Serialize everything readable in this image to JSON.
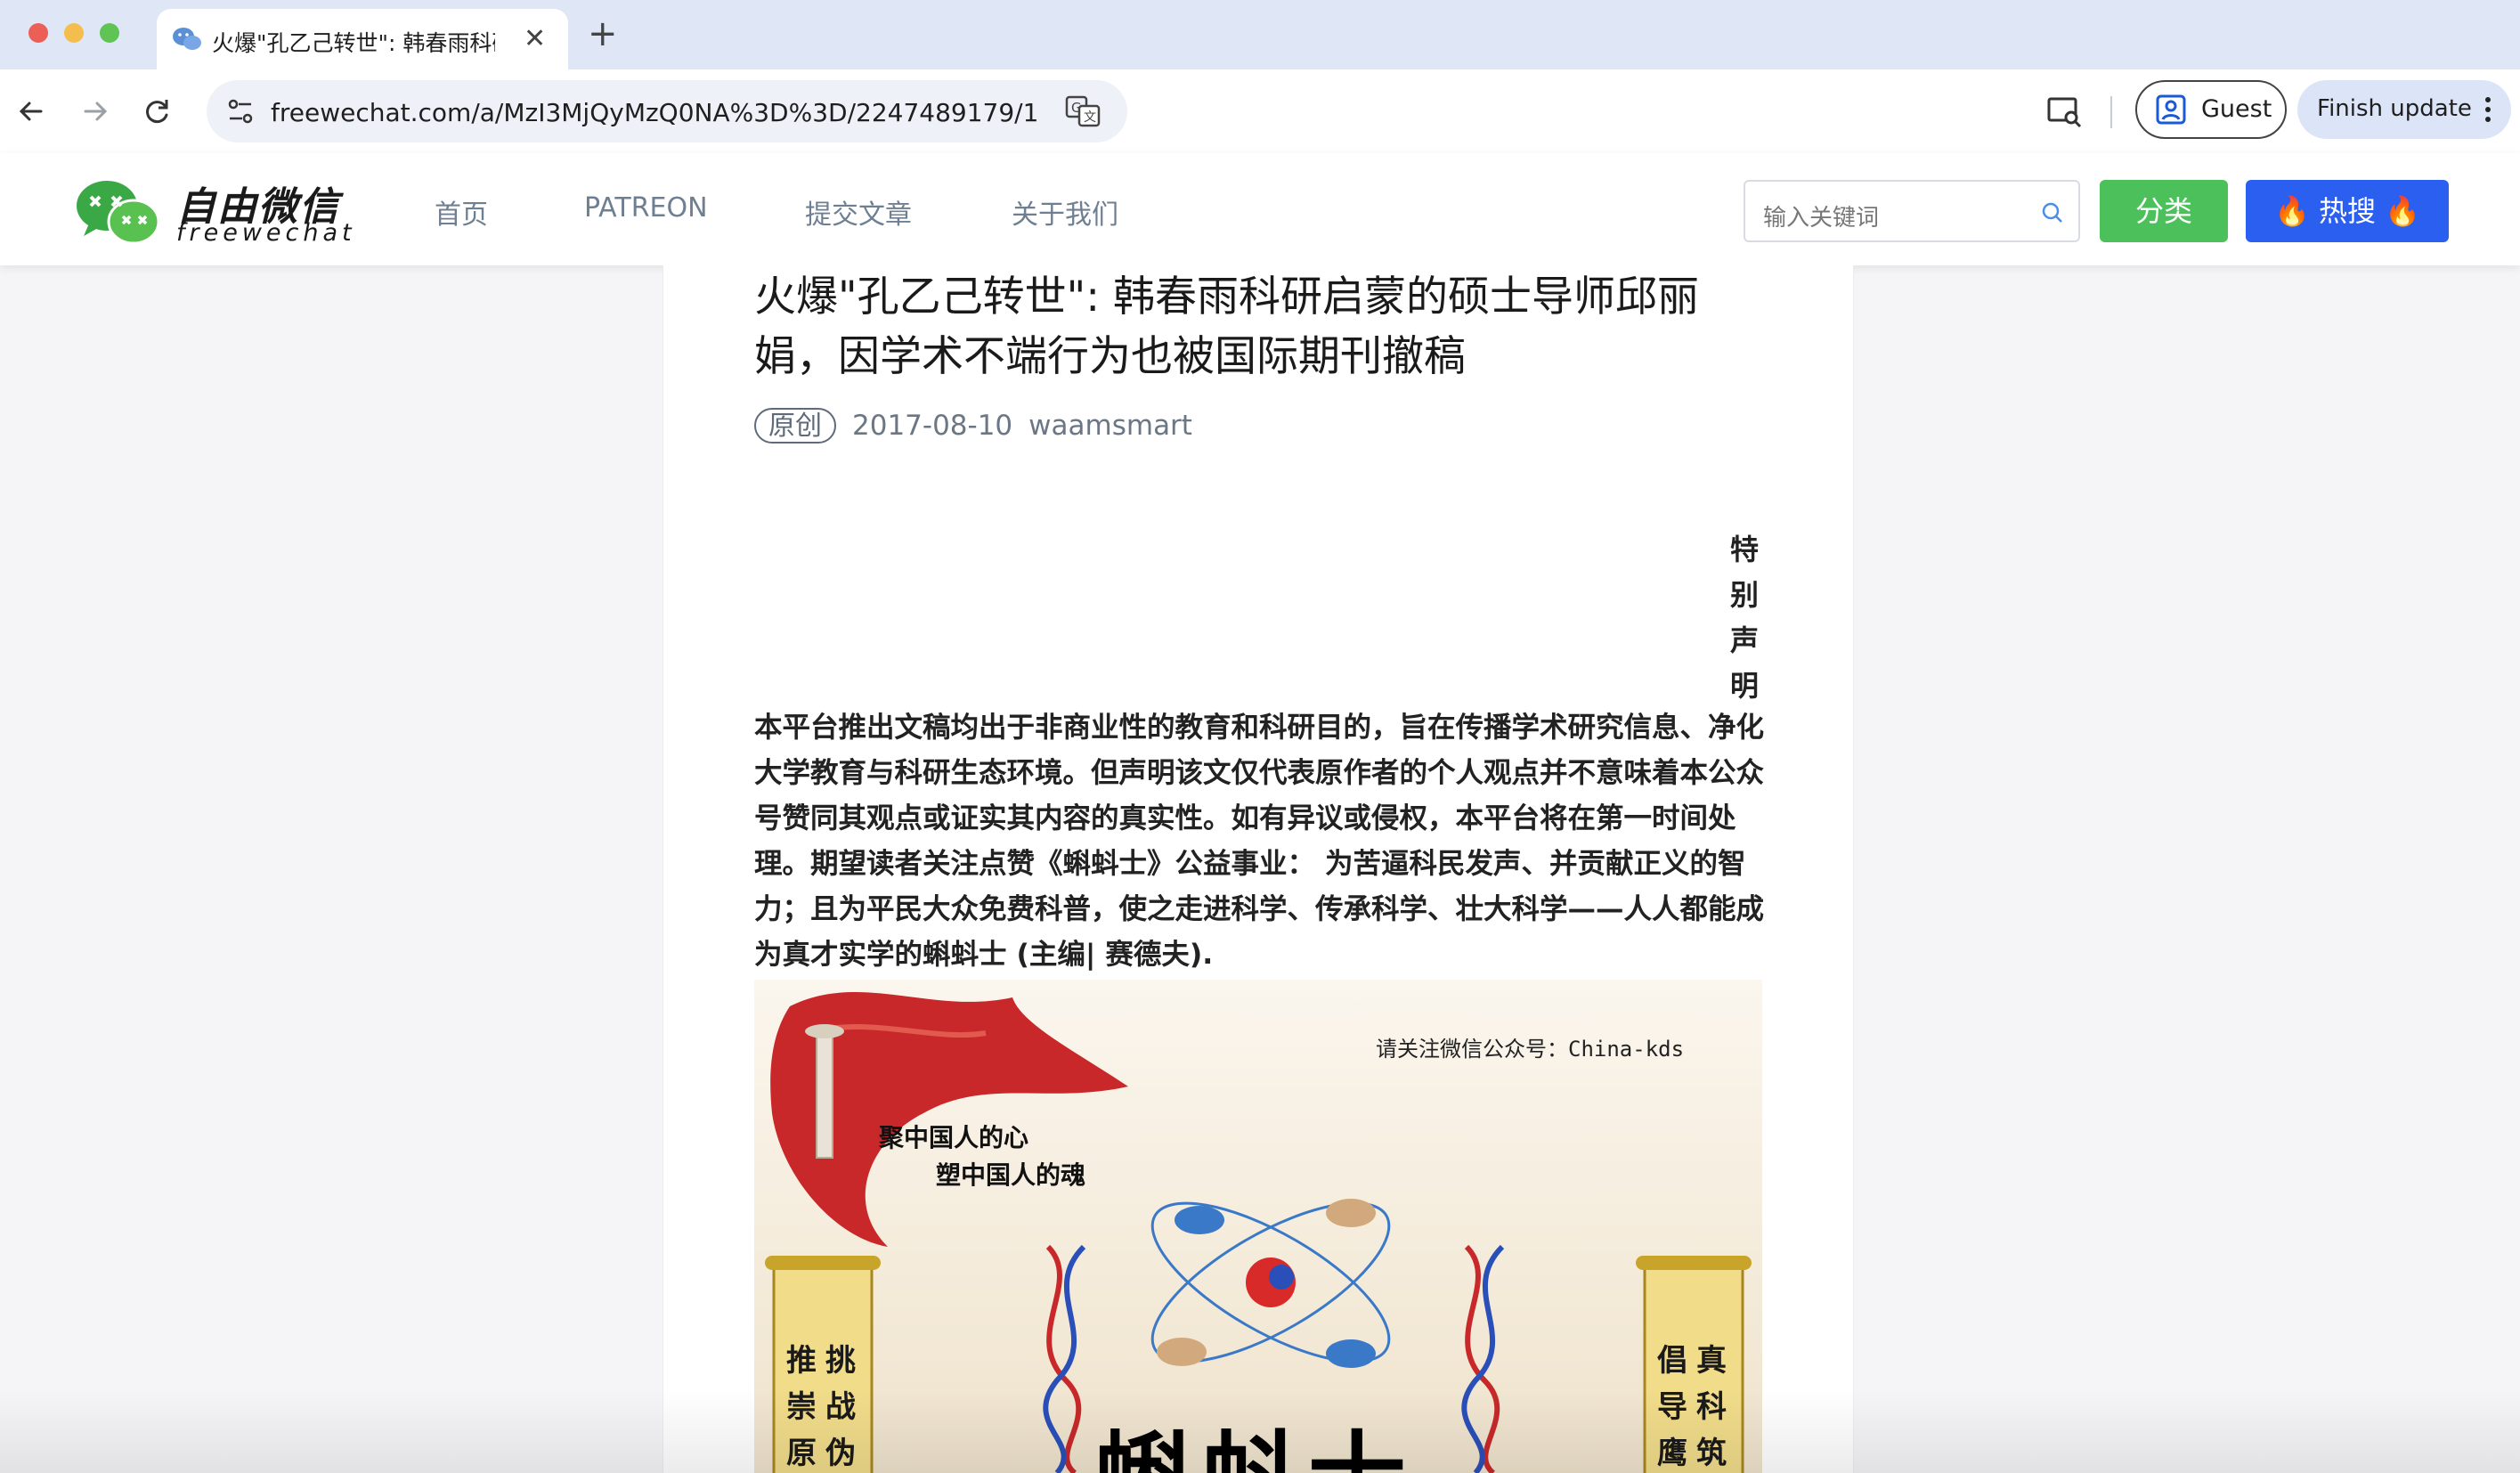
{
  "browser": {
    "tab": {
      "title": "火爆\"孔乙己转世\": 韩春雨科研启蒙的硕士导师邱丽娟，因学术不端行为也被国际期刊撤稿",
      "close": "✕"
    },
    "new_tab": "+",
    "url": "freewechat.com/a/MzI3MjQyMzQ0NA%3D%3D/2247489179/1",
    "profile_label": "Guest",
    "update_label": "Finish update"
  },
  "site": {
    "logo_cn": "自由微信",
    "logo_en": "freewechat",
    "nav": [
      "首页",
      "PATREON",
      "提交文章",
      "关于我们"
    ],
    "search_placeholder": "输入关键词",
    "category_button": "分类",
    "hot_button": "🔥 热搜 🔥"
  },
  "article": {
    "title": "火爆\"孔乙己转世\": 韩春雨科研启蒙的硕士导师邱丽娟，因学术不端行为也被国际期刊撤稿",
    "tag": "原创",
    "date": "2017-08-10",
    "author": "waamsmart",
    "notice_heading": [
      "特",
      "别",
      "声",
      "明"
    ],
    "notice_body": "本平台推出文稿均出于非商业性的教育和科研目的，旨在传播学术研究信息、净化大学教育与科研生态环境。但声明该文仅代表原作者的个人观点并不意味着本公众号赞同其观点或证实其内容的真实性。如有异议或侵权，本平台将在第一时间处理。期望读者关注点赞《蝌蚪士》公益事业： 为苦逼科民发声、并贡献正义的智力；且为平民大众免费科普，使之走进科学、传承科学、壮大科学——人人都能成为真才实学的蝌蚪士 (主编| 赛德夫).",
    "poster": {
      "note": "请关注微信公众号：China-kds",
      "slogan_1": "聚中国人的心",
      "slogan_2": "塑中国人的魂",
      "big_title": "蝌蚪士",
      "scroll_left_col1": "推崇原创",
      "scroll_left_col2": "挑战伪科",
      "scroll_right_col1": "倡导鹰派",
      "scroll_right_col2": "真科筑梦"
    }
  },
  "colors": {
    "green": "#4cc05a",
    "blue": "#2b5ff0",
    "tabstrip": "#dfe7f7"
  }
}
